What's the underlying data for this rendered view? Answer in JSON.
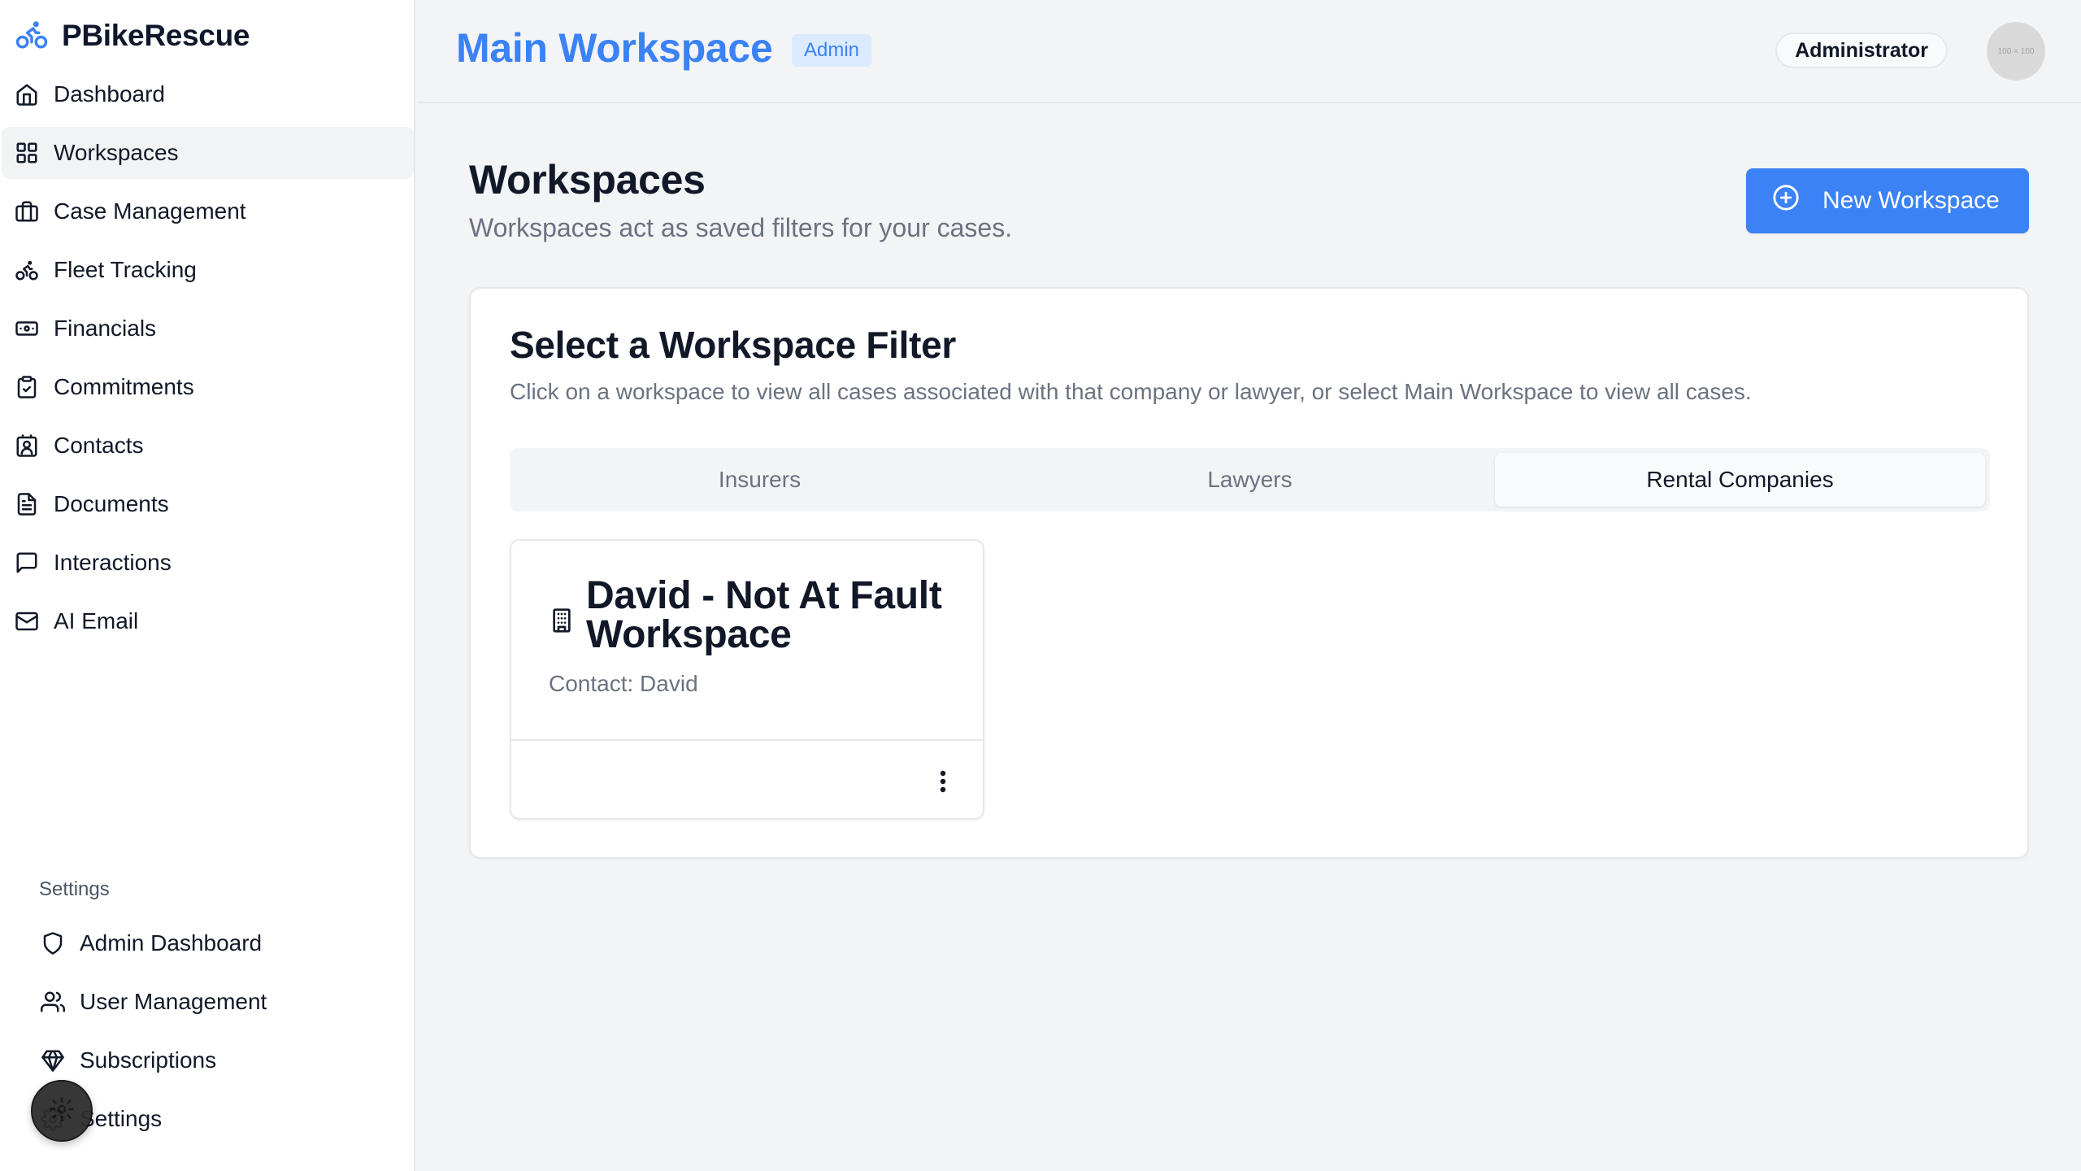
{
  "app": {
    "name": "PBikeRescue",
    "logo_icon": "bicycle-icon",
    "accent_color": "#3b82f6"
  },
  "sidebar": {
    "items": [
      {
        "label": "Dashboard",
        "icon": "home-icon"
      },
      {
        "label": "Workspaces",
        "icon": "grid-icon",
        "active": true
      },
      {
        "label": "Case Management",
        "icon": "briefcase-icon"
      },
      {
        "label": "Fleet Tracking",
        "icon": "bicycle-icon"
      },
      {
        "label": "Financials",
        "icon": "banknote-icon"
      },
      {
        "label": "Commitments",
        "icon": "clipboard-check-icon"
      },
      {
        "label": "Contacts",
        "icon": "contact-card-icon"
      },
      {
        "label": "Documents",
        "icon": "file-text-icon"
      },
      {
        "label": "Interactions",
        "icon": "message-square-icon"
      },
      {
        "label": "AI Email",
        "icon": "mail-icon"
      }
    ],
    "settings_heading": "Settings",
    "settings_items": [
      {
        "label": "Admin Dashboard",
        "icon": "shield-icon"
      },
      {
        "label": "User Management",
        "icon": "users-icon"
      },
      {
        "label": "Subscriptions",
        "icon": "gem-icon"
      },
      {
        "label": "Settings",
        "icon": "gear-icon"
      }
    ]
  },
  "header": {
    "workspace_title": "Main Workspace",
    "badge": "Admin",
    "role": "Administrator",
    "avatar_text": "100 × 100"
  },
  "main": {
    "title": "Workspaces",
    "subtitle": "Workspaces act as saved filters for your cases.",
    "new_button_label": "New Workspace",
    "filter_card": {
      "title": "Select a Workspace Filter",
      "description": "Click on a workspace to view all cases associated with that company or lawyer, or select Main Workspace to view all cases.",
      "tabs": [
        {
          "label": "Insurers"
        },
        {
          "label": "Lawyers"
        },
        {
          "label": "Rental Companies",
          "active": true
        }
      ],
      "workspaces": [
        {
          "name": "David - Not At Fault Workspace",
          "contact": "Contact: David",
          "icon": "building-icon"
        }
      ]
    }
  }
}
